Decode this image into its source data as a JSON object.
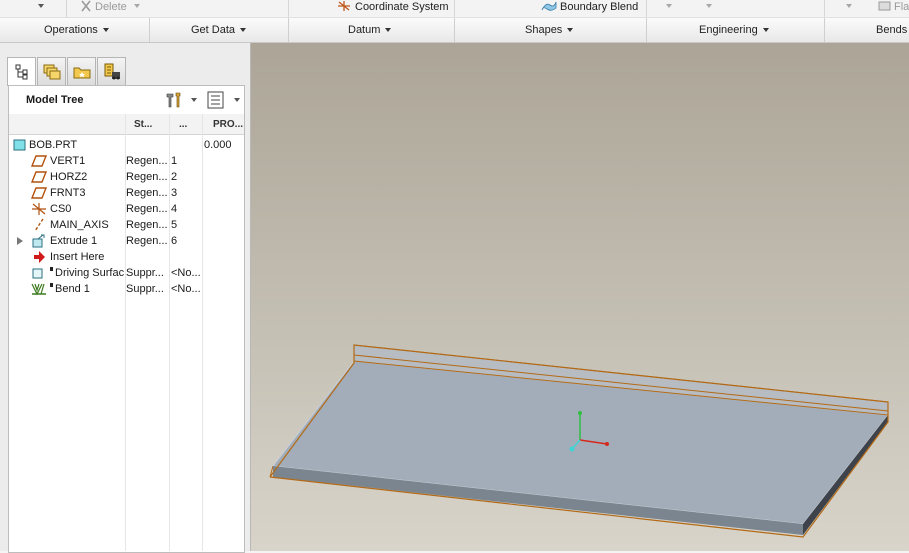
{
  "ribbon_top": {
    "delete_label": "Delete",
    "coordinate_system_label": "Coordinate System",
    "boundary_blend_label": "Boundary Blend",
    "flat_label": "Fla"
  },
  "groups": [
    {
      "label": "Operations"
    },
    {
      "label": "Get Data"
    },
    {
      "label": "Datum"
    },
    {
      "label": "Shapes"
    },
    {
      "label": "Engineering"
    },
    {
      "label": "Bends"
    }
  ],
  "model_tree": {
    "title": "Model Tree",
    "columns": [
      "St...",
      "...",
      "PRO..."
    ],
    "rows": [
      {
        "name": "BOB.PRT",
        "status": "",
        "num": "",
        "value": "0.000",
        "icon": "part-icon"
      },
      {
        "name": "VERT1",
        "status": "Regen...",
        "num": "1",
        "value": "",
        "icon": "datum-plane-icon"
      },
      {
        "name": "HORZ2",
        "status": "Regen...",
        "num": "2",
        "value": "",
        "icon": "datum-plane-icon"
      },
      {
        "name": "FRNT3",
        "status": "Regen...",
        "num": "3",
        "value": "",
        "icon": "datum-plane-icon"
      },
      {
        "name": "CS0",
        "status": "Regen...",
        "num": "4",
        "value": "",
        "icon": "coordinate-system-icon"
      },
      {
        "name": "MAIN_AXIS",
        "status": "Regen...",
        "num": "5",
        "value": "",
        "icon": "axis-icon"
      },
      {
        "name": "Extrude 1",
        "status": "Regen...",
        "num": "6",
        "value": "",
        "icon": "extrude-icon"
      },
      {
        "name": "Insert Here",
        "status": "",
        "num": "",
        "value": "",
        "icon": "insert-arrow-icon"
      },
      {
        "name": "Driving Surfac",
        "status": "Suppr...",
        "num": "<No...",
        "value": "",
        "icon": "driving-surface-icon"
      },
      {
        "name": "Bend 1",
        "status": "Suppr...",
        "num": "<No...",
        "value": "",
        "icon": "bend-icon"
      }
    ]
  },
  "colors": {
    "viewport_top": "#aca597",
    "viewport_bottom": "#d8d4ca",
    "plate_top": "#a3adb9",
    "plate_edge": "#b26a17"
  }
}
